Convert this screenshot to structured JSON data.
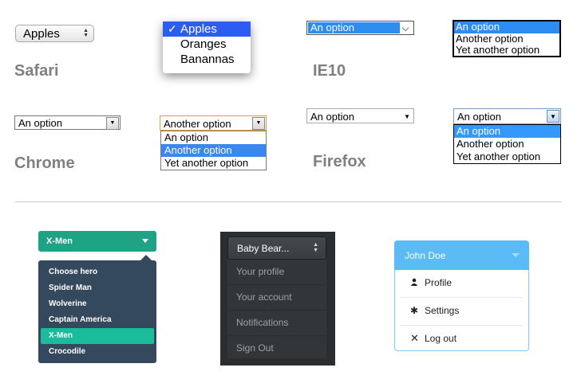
{
  "safari": {
    "label": "Safari",
    "select_value": "Apples",
    "menu": {
      "checkmark": "✓",
      "options": [
        "Apples",
        "Oranges",
        "Banannas"
      ],
      "selected_index": 0
    }
  },
  "ie10": {
    "label": "IE10",
    "select_value": "An option",
    "list": [
      "An option",
      "Another option",
      "Yet another option"
    ]
  },
  "chrome": {
    "label": "Chrome",
    "select_value": "An option",
    "open_select_value": "Another option",
    "list": [
      "An option",
      "Another option",
      "Yet another option"
    ]
  },
  "firefox": {
    "label": "Firefox",
    "select_value": "An option",
    "open_select_value": "An option",
    "list": [
      "An option",
      "Another option",
      "Yet another option"
    ]
  },
  "flat_dropdown": {
    "button_label": "X-Men",
    "items": [
      "Choose hero",
      "Spider Man",
      "Wolverine",
      "Captain America",
      "X-Men",
      "Crocodile"
    ],
    "selected_index": 4,
    "colors": {
      "accent": "#1abc9c",
      "menu_bg": "#34495e"
    }
  },
  "dark_dropdown": {
    "button_label": "Baby Bear...",
    "items": [
      "Your profile",
      "Your account",
      "Notifications",
      "Sign Out"
    ]
  },
  "light_dropdown": {
    "button_label": "John Doe",
    "items": [
      {
        "icon": "user-icon",
        "label": "Profile"
      },
      {
        "icon": "gear-icon",
        "label": "Settings"
      },
      {
        "icon": "close-icon",
        "label": "Log out"
      }
    ],
    "colors": {
      "accent": "#5bbcf5"
    }
  }
}
